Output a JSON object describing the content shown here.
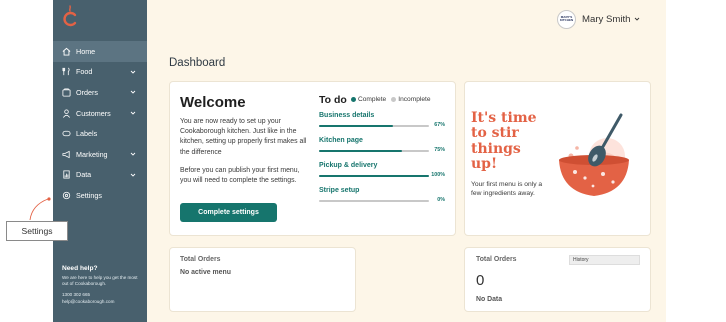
{
  "brand": {
    "logo_icon": "cookaborough-c-logo-icon",
    "accent_color": "#e36245"
  },
  "sidebar": {
    "items": [
      {
        "label": "Home",
        "icon": "home-icon",
        "active": true,
        "has_chevron": false
      },
      {
        "label": "Food",
        "icon": "fork-knife-icon",
        "active": false,
        "has_chevron": true
      },
      {
        "label": "Orders",
        "icon": "orders-icon",
        "active": false,
        "has_chevron": true
      },
      {
        "label": "Customers",
        "icon": "user-icon",
        "active": false,
        "has_chevron": true
      },
      {
        "label": "Labels",
        "icon": "label-icon",
        "active": false,
        "has_chevron": false
      },
      {
        "label": "Marketing",
        "icon": "megaphone-icon",
        "active": false,
        "has_chevron": true
      },
      {
        "label": "Data",
        "icon": "data-icon",
        "active": false,
        "has_chevron": true
      },
      {
        "label": "Settings",
        "icon": "settings-icon",
        "active": false,
        "has_chevron": false
      }
    ],
    "help": {
      "title": "Need help?",
      "text": "We are here to help you get the most out of Cookaborough.",
      "phone": "1300 302 665",
      "email": "help@cookaborough.com"
    },
    "color": "#48606d"
  },
  "header": {
    "user_name": "Mary Smith",
    "avatar_text_line1": "MARY'S",
    "avatar_text_line2": "KITCHEN"
  },
  "main": {
    "page_title": "Dashboard",
    "welcome": {
      "title": "Welcome",
      "paragraph1": "You are now ready to set up your Cookaborough kitchen. Just like in the kitchen, setting up properly first makes all the difference",
      "paragraph2": "Before you can publish your first menu, you will need to complete the settings.",
      "button_label": "Complete settings"
    },
    "todo": {
      "title": "To do",
      "legend_complete": "Complete",
      "legend_incomplete": "Incomplete",
      "complete_color": "#16756d",
      "incomplete_color": "#c8c8c8",
      "tasks": [
        {
          "name": "Business details",
          "percent_label": "67%",
          "progress": 0.67
        },
        {
          "name": "Kitchen page",
          "percent_label": "75%",
          "progress": 0.75
        },
        {
          "name": "Pickup & delivery",
          "percent_label": "100%",
          "progress": 1.0
        },
        {
          "name": "Stripe setup",
          "percent_label": "0%",
          "progress": 0.0
        }
      ]
    },
    "promo": {
      "title": "It's time to stir things up!",
      "text": "Your first menu is only a few ingredients away.",
      "illustration": "mixing-bowl-spoon-illustration"
    },
    "orders_left": {
      "title": "Total Orders",
      "message": "No active menu"
    },
    "orders_right": {
      "title": "Total Orders",
      "value": "0",
      "message": "No Data",
      "history_label": "History"
    }
  },
  "tooltip": {
    "label": "Settings"
  }
}
